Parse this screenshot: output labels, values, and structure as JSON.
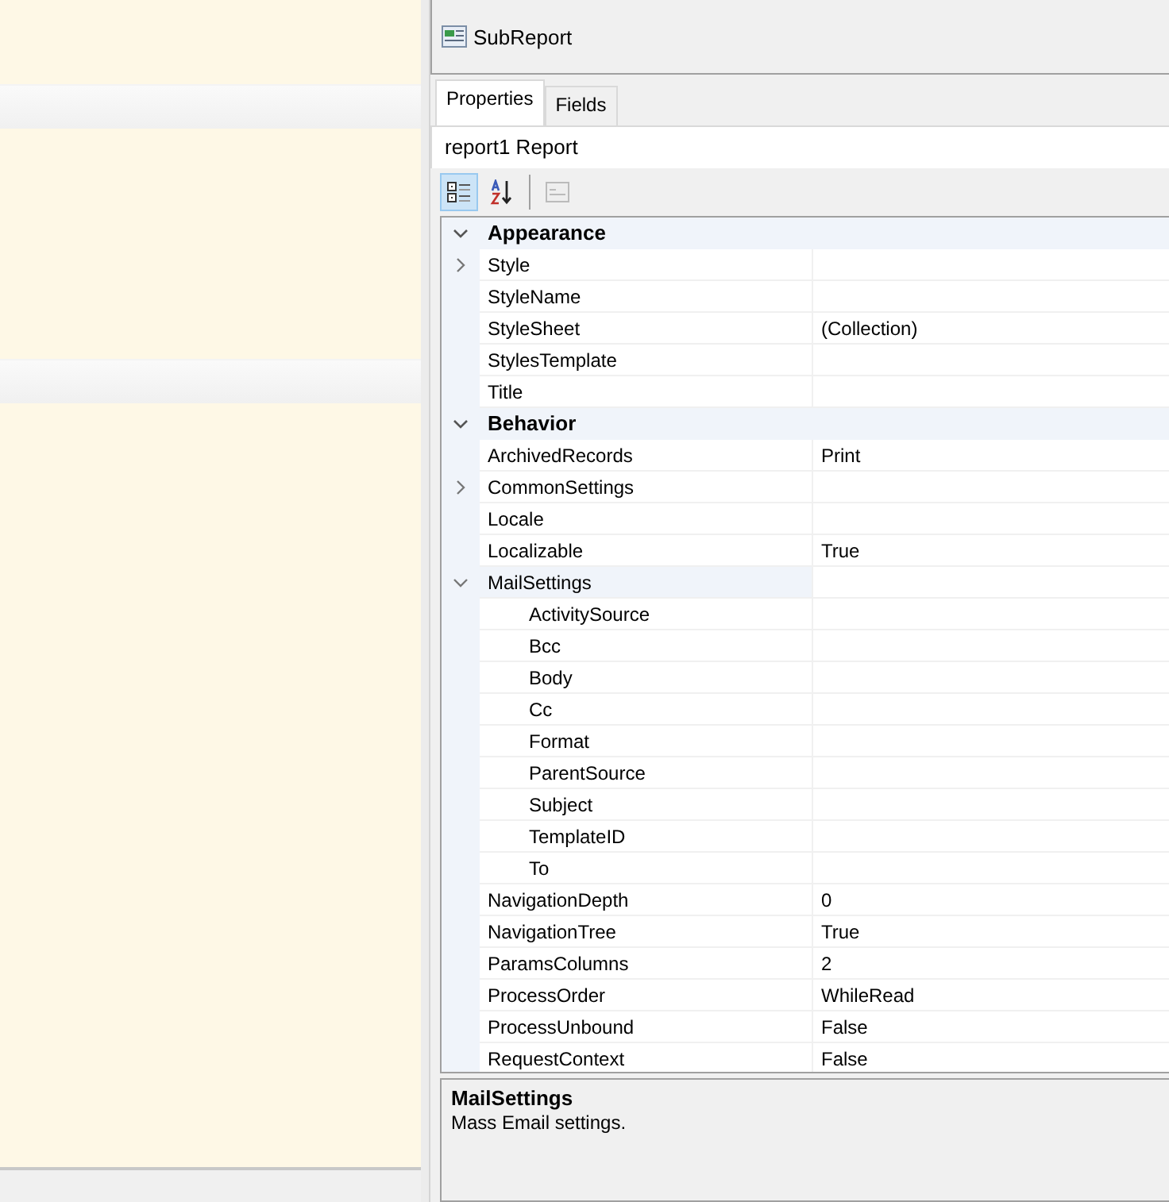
{
  "toolbox": {
    "items": [
      {
        "label": "SubReport"
      }
    ]
  },
  "tabs": [
    {
      "label": "Properties",
      "selected": true
    },
    {
      "label": "Fields",
      "selected": false
    }
  ],
  "object_name": "report1 Report",
  "toolbar": [
    {
      "kind": "categorized",
      "selected": true
    },
    {
      "kind": "alphabetical",
      "selected": false
    },
    {
      "kind": "pages",
      "selected": false
    }
  ],
  "categories": [
    {
      "name": "Appearance",
      "expanded": true,
      "properties": [
        {
          "name": "Style",
          "expanded": false,
          "selected": false
        },
        {
          "name": "StyleName",
          "selected": false
        },
        {
          "name": "StyleSheet",
          "value": "(Collection)",
          "selected": false
        },
        {
          "name": "StylesTemplate",
          "selected": false
        },
        {
          "name": "Title",
          "selected": false
        }
      ]
    },
    {
      "name": "Behavior",
      "expanded": true,
      "properties": [
        {
          "name": "ArchivedRecords",
          "value": "Print",
          "selected": false
        },
        {
          "name": "CommonSettings",
          "expanded": false,
          "selected": false
        },
        {
          "name": "Locale",
          "selected": false
        },
        {
          "name": "Localizable",
          "value": "True",
          "selected": false
        },
        {
          "name": "MailSettings",
          "expanded": true,
          "selected": true,
          "children": [
            {
              "name": "ActivitySource"
            },
            {
              "name": "Bcc"
            },
            {
              "name": "Body"
            },
            {
              "name": "Cc"
            },
            {
              "name": "Format"
            },
            {
              "name": "ParentSource"
            },
            {
              "name": "Subject"
            },
            {
              "name": "TemplateID"
            },
            {
              "name": "To"
            }
          ]
        },
        {
          "name": "NavigationDepth",
          "value": "0",
          "selected": false
        },
        {
          "name": "NavigationTree",
          "value": "True",
          "selected": false
        },
        {
          "name": "ParamsColumns",
          "value": "2",
          "selected": false
        },
        {
          "name": "ProcessOrder",
          "value": "WhileRead",
          "selected": false
        },
        {
          "name": "ProcessUnbound",
          "value": "False",
          "selected": false
        },
        {
          "name": "RequestContext",
          "value": "False",
          "selected": false
        }
      ]
    }
  ],
  "description": {
    "title": "MailSettings",
    "text": "Mass Email settings."
  }
}
